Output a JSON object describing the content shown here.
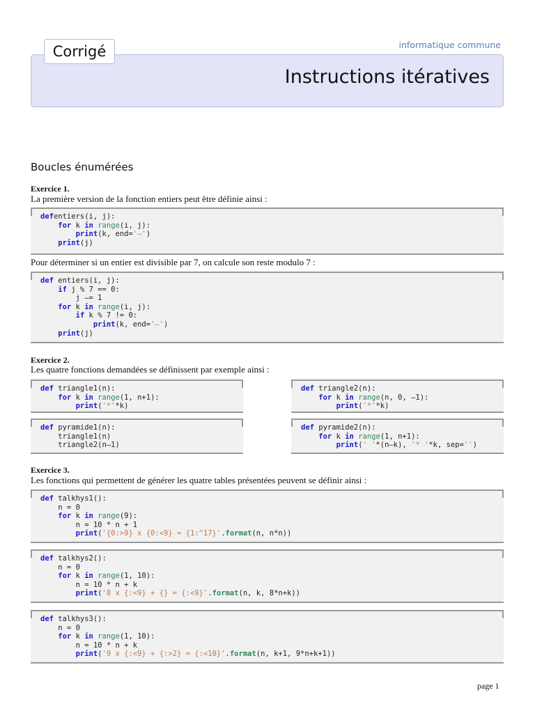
{
  "header": {
    "tab": "Corrigé",
    "subject": "informatique commune",
    "title": "Instructions itératives"
  },
  "section": "Boucles énumérées",
  "ex1": {
    "label": "Exercice 1.",
    "intro": "La première version de la fonction entiers peut être définie ainsi :",
    "between": "Pour déterminer si un entier est divisible par 7, on calcule son reste modulo 7 :"
  },
  "ex2": {
    "label": "Exercice 2.",
    "intro": "Les quatre fonctions demandées se définissent par exemple ainsi :"
  },
  "ex3": {
    "label": "Exercice 3.",
    "intro": "Les fonctions qui permettent de générer les quatre tables présentées peuvent se définir ainsi :"
  },
  "page": "page 1",
  "code": {
    "c1": [
      [
        [
          "k",
          "def"
        ],
        [
          "",
          "entiers(i, j):"
        ]
      ],
      [
        [
          "",
          "    "
        ],
        [
          "k",
          "for"
        ],
        [
          "",
          " k "
        ],
        [
          "k",
          "in"
        ],
        [
          "",
          " "
        ],
        [
          "b",
          "range"
        ],
        [
          "",
          "(i, j):"
        ]
      ],
      [
        [
          "",
          "        "
        ],
        [
          "k",
          "print"
        ],
        [
          "",
          "(k, end="
        ],
        [
          "s",
          "'–'"
        ],
        [
          "",
          ")"
        ]
      ],
      [
        [
          "",
          "    "
        ],
        [
          "k",
          "print"
        ],
        [
          "",
          "(j)"
        ]
      ]
    ],
    "c2": [
      [
        [
          "k",
          "def"
        ],
        [
          "",
          " entiers(i, j):"
        ]
      ],
      [
        [
          "",
          "    "
        ],
        [
          "k",
          "if"
        ],
        [
          "",
          " j % 7 == 0:"
        ]
      ],
      [
        [
          "",
          "        j –= 1"
        ]
      ],
      [
        [
          "",
          "    "
        ],
        [
          "k",
          "for"
        ],
        [
          "",
          " k "
        ],
        [
          "k",
          "in"
        ],
        [
          "",
          " "
        ],
        [
          "b",
          "range"
        ],
        [
          "",
          "(i, j):"
        ]
      ],
      [
        [
          "",
          "        "
        ],
        [
          "k",
          "if"
        ],
        [
          "",
          " k % 7 != 0:"
        ]
      ],
      [
        [
          "",
          "            "
        ],
        [
          "k",
          "print"
        ],
        [
          "",
          "(k, end="
        ],
        [
          "s",
          "'–'"
        ],
        [
          "",
          ")"
        ]
      ],
      [
        [
          "",
          "    "
        ],
        [
          "k",
          "print"
        ],
        [
          "",
          "(j)"
        ]
      ]
    ],
    "t1": [
      [
        [
          "k",
          "def"
        ],
        [
          "",
          " triangle1(n):"
        ]
      ],
      [
        [
          "",
          "    "
        ],
        [
          "k",
          "for"
        ],
        [
          "",
          " k "
        ],
        [
          "k",
          "in"
        ],
        [
          "",
          " "
        ],
        [
          "b",
          "range"
        ],
        [
          "",
          "(1, n+1):"
        ]
      ],
      [
        [
          "",
          "        "
        ],
        [
          "k",
          "print"
        ],
        [
          "",
          "("
        ],
        [
          "s",
          "'*'"
        ],
        [
          "",
          "*k)"
        ]
      ]
    ],
    "t2": [
      [
        [
          "k",
          "def"
        ],
        [
          "",
          " triangle2(n):"
        ]
      ],
      [
        [
          "",
          "    "
        ],
        [
          "k",
          "for"
        ],
        [
          "",
          " k "
        ],
        [
          "k",
          "in"
        ],
        [
          "",
          " "
        ],
        [
          "b",
          "range"
        ],
        [
          "",
          "(n, 0, –1):"
        ]
      ],
      [
        [
          "",
          "        "
        ],
        [
          "k",
          "print"
        ],
        [
          "",
          "("
        ],
        [
          "s",
          "'*'"
        ],
        [
          "",
          "*k)"
        ]
      ]
    ],
    "p1": [
      [
        [
          "k",
          "def"
        ],
        [
          "",
          " pyramide1(n):"
        ]
      ],
      [
        [
          "",
          "    triangle1(n)"
        ]
      ],
      [
        [
          "",
          "    triangle2(n–1)"
        ]
      ]
    ],
    "p2": [
      [
        [
          "k",
          "def"
        ],
        [
          "",
          " pyramide2(n):"
        ]
      ],
      [
        [
          "",
          "    "
        ],
        [
          "k",
          "for"
        ],
        [
          "",
          " k "
        ],
        [
          "k",
          "in"
        ],
        [
          "",
          " "
        ],
        [
          "b",
          "range"
        ],
        [
          "",
          "(1, n+1):"
        ]
      ],
      [
        [
          "",
          "        "
        ],
        [
          "k",
          "print"
        ],
        [
          "",
          "("
        ],
        [
          "s",
          "' '"
        ],
        [
          "",
          "*(n–k), "
        ],
        [
          "s",
          "'* '"
        ],
        [
          "",
          "*k, sep="
        ],
        [
          "s",
          "''"
        ],
        [
          "",
          ")"
        ]
      ]
    ],
    "h1": [
      [
        [
          "k",
          "def"
        ],
        [
          "",
          " talkhys1():"
        ]
      ],
      [
        [
          "",
          "    n = 0"
        ]
      ],
      [
        [
          "",
          "    "
        ],
        [
          "k",
          "for"
        ],
        [
          "",
          " k "
        ],
        [
          "k",
          "in"
        ],
        [
          "",
          " "
        ],
        [
          "b",
          "range"
        ],
        [
          "",
          "(9):"
        ]
      ],
      [
        [
          "",
          "        n = 10 * n + 1"
        ]
      ],
      [
        [
          "",
          "        "
        ],
        [
          "k",
          "print"
        ],
        [
          "",
          "("
        ],
        [
          "s",
          "'{0:>9} x {0:<9} = {1:^17}'"
        ],
        [
          "",
          "."
        ],
        [
          "f",
          "format"
        ],
        [
          "",
          "(n, n*n))"
        ]
      ]
    ],
    "h2": [
      [
        [
          "k",
          "def"
        ],
        [
          "",
          " talkhys2():"
        ]
      ],
      [
        [
          "",
          "    n = 0"
        ]
      ],
      [
        [
          "",
          "    "
        ],
        [
          "k",
          "for"
        ],
        [
          "",
          " k "
        ],
        [
          "k",
          "in"
        ],
        [
          "",
          " "
        ],
        [
          "b",
          "range"
        ],
        [
          "",
          "(1, 10):"
        ]
      ],
      [
        [
          "",
          "        n = 10 * n + k"
        ]
      ],
      [
        [
          "",
          "        "
        ],
        [
          "k",
          "print"
        ],
        [
          "",
          "("
        ],
        [
          "s",
          "'8 x {:<9} + {} = {:<9}'"
        ],
        [
          "",
          "."
        ],
        [
          "f",
          "format"
        ],
        [
          "",
          "(n, k, 8*n+k))"
        ]
      ]
    ],
    "h3": [
      [
        [
          "k",
          "def"
        ],
        [
          "",
          " talkhys3():"
        ]
      ],
      [
        [
          "",
          "    n = 0"
        ]
      ],
      [
        [
          "",
          "    "
        ],
        [
          "k",
          "for"
        ],
        [
          "",
          " k "
        ],
        [
          "k",
          "in"
        ],
        [
          "",
          " "
        ],
        [
          "b",
          "range"
        ],
        [
          "",
          "(1, 10):"
        ]
      ],
      [
        [
          "",
          "        n = 10 * n + k"
        ]
      ],
      [
        [
          "",
          "        "
        ],
        [
          "k",
          "print"
        ],
        [
          "",
          "("
        ],
        [
          "s",
          "'9 x {:<9} + {:>2} = {:<10}'"
        ],
        [
          "",
          "."
        ],
        [
          "f",
          "format"
        ],
        [
          "",
          "(n, k+1, 9*n+k+1))"
        ]
      ]
    ]
  }
}
